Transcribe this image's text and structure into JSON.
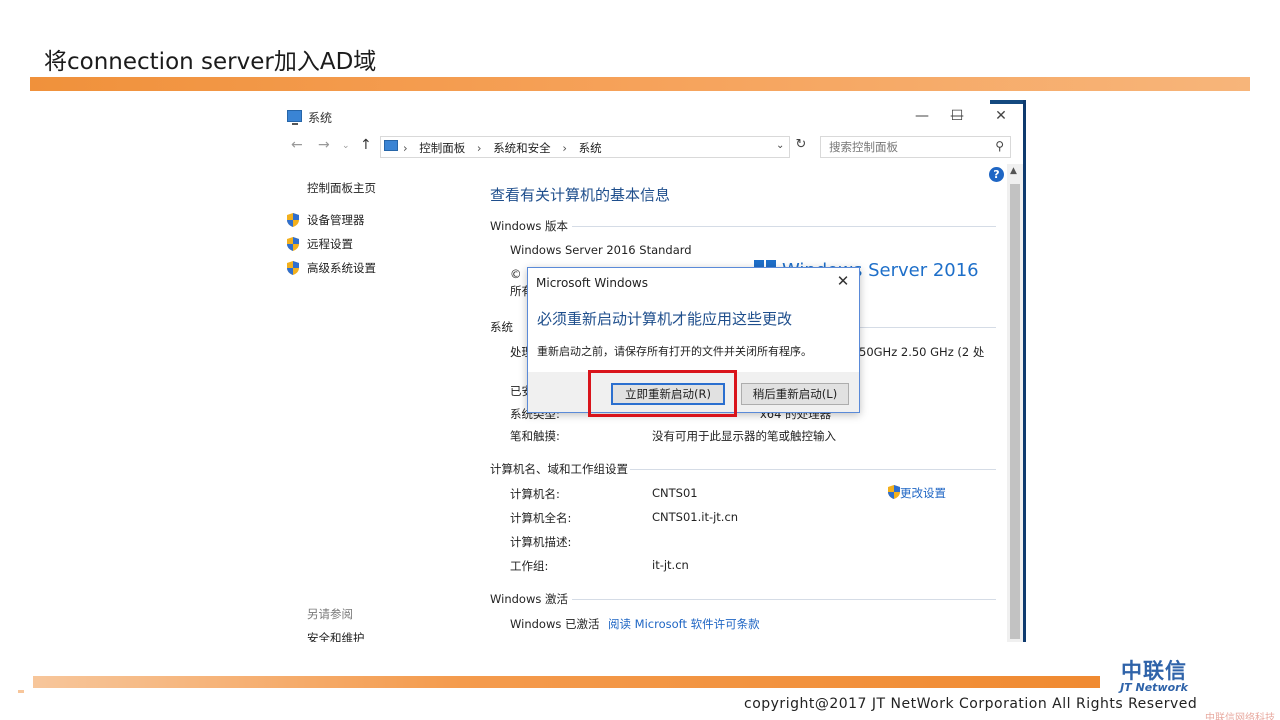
{
  "slide": {
    "title": "将connection server加入AD域",
    "copyright": "copyright@2017  JT NetWork Corporation All Rights Reserved",
    "logo_cn": "中联信",
    "logo_en": "JT Network",
    "watermark": "中联信网络科技"
  },
  "window": {
    "title": "系统",
    "controls": {
      "minimize": "—",
      "maximize": "☐",
      "close": "✕"
    },
    "breadcrumbs": [
      "控制面板",
      "系统和安全",
      "系统"
    ],
    "search_placeholder": "搜索控制面板"
  },
  "sidebar": {
    "home": "控制面板主页",
    "items": [
      {
        "label": "设备管理器"
      },
      {
        "label": "远程设置"
      },
      {
        "label": "高级系统设置"
      }
    ],
    "see_also": "另请参阅",
    "security": "安全和维护"
  },
  "main": {
    "title": "查看有关计算机的基本信息",
    "edition_section": "Windows 版本",
    "edition": "Windows Server 2016 Standard",
    "copyright_partial_1": "©",
    "copyright_partial_2": "所有",
    "windows_logo_text": "Windows Server 2016",
    "system_section": "系统",
    "processor_label_partial": "处理",
    "processor_value_partial": "50GHz   2.50 GHz  (2 处",
    "installed_label_partial": "已安",
    "system_type_label_partial": "系统类型:",
    "system_type_value_partial": "x64 的处理器",
    "pen_label": "笔和触摸:",
    "pen_value": "没有可用于此显示器的笔或触控输入",
    "computer_section": "计算机名、域和工作组设置",
    "computer_name_label": "计算机名:",
    "computer_name": "CNTS01",
    "change_settings": "更改设置",
    "full_name_label": "计算机全名:",
    "full_name": "CNTS01.it-jt.cn",
    "description_label": "计算机描述:",
    "workgroup_label": "工作组:",
    "workgroup": "it-jt.cn",
    "activation_section": "Windows 激活",
    "activated": "Windows 已激活",
    "license_link": "阅读 Microsoft 软件许可条款"
  },
  "dialog": {
    "title": "Microsoft Windows",
    "heading": "必须重新启动计算机才能应用这些更改",
    "message": "重新启动之前，请保存所有打开的文件并关闭所有程序。",
    "restart_now": "立即重新启动(R)",
    "restart_later": "稍后重新启动(L)"
  }
}
